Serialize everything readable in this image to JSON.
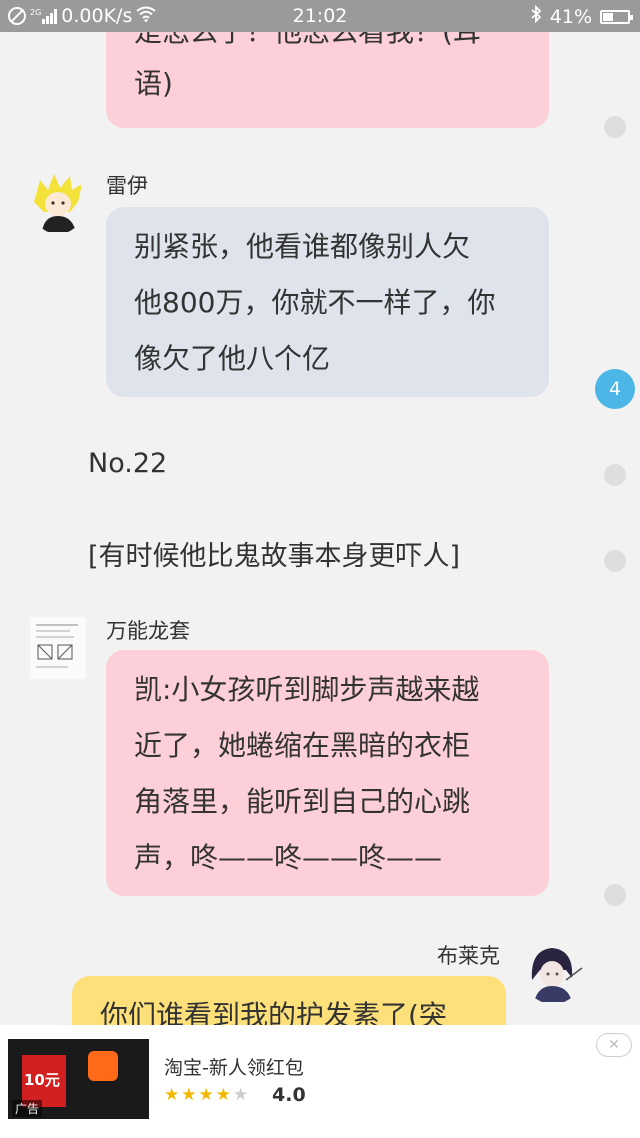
{
  "status_bar": {
    "network_type": "2G",
    "speed": "0.00K/s",
    "time": "21:02",
    "battery": "41%"
  },
  "chat": {
    "messages": [
      {
        "text_line1": "是怎么了？他怎么看我？(耳",
        "text_line2": "语)"
      },
      {
        "name": "雷伊",
        "lines": [
          "别紧张，他看谁都像别人欠",
          "他800万，你就不一样了，你",
          "像欠了他八个亿"
        ]
      },
      {
        "narration1": "No.22"
      },
      {
        "narration2": "[有时候他比鬼故事本身更吓人]"
      },
      {
        "name": "万能龙套",
        "lines": [
          "凯:小女孩听到脚步声越来越",
          "近了，她蜷缩在黑暗的衣柜",
          "角落里，能听到自己的心跳",
          "声，咚——咚——咚——"
        ]
      },
      {
        "name": "布莱克",
        "lines": [
          "你们谁看到我的护发素了(突"
        ]
      }
    ],
    "comment_badge": "4"
  },
  "ad": {
    "coupon": "10元",
    "tag": "广告",
    "title": "淘宝-新人领红包",
    "rating": "4.0",
    "stars": 4,
    "close_icon": "close-icon"
  }
}
